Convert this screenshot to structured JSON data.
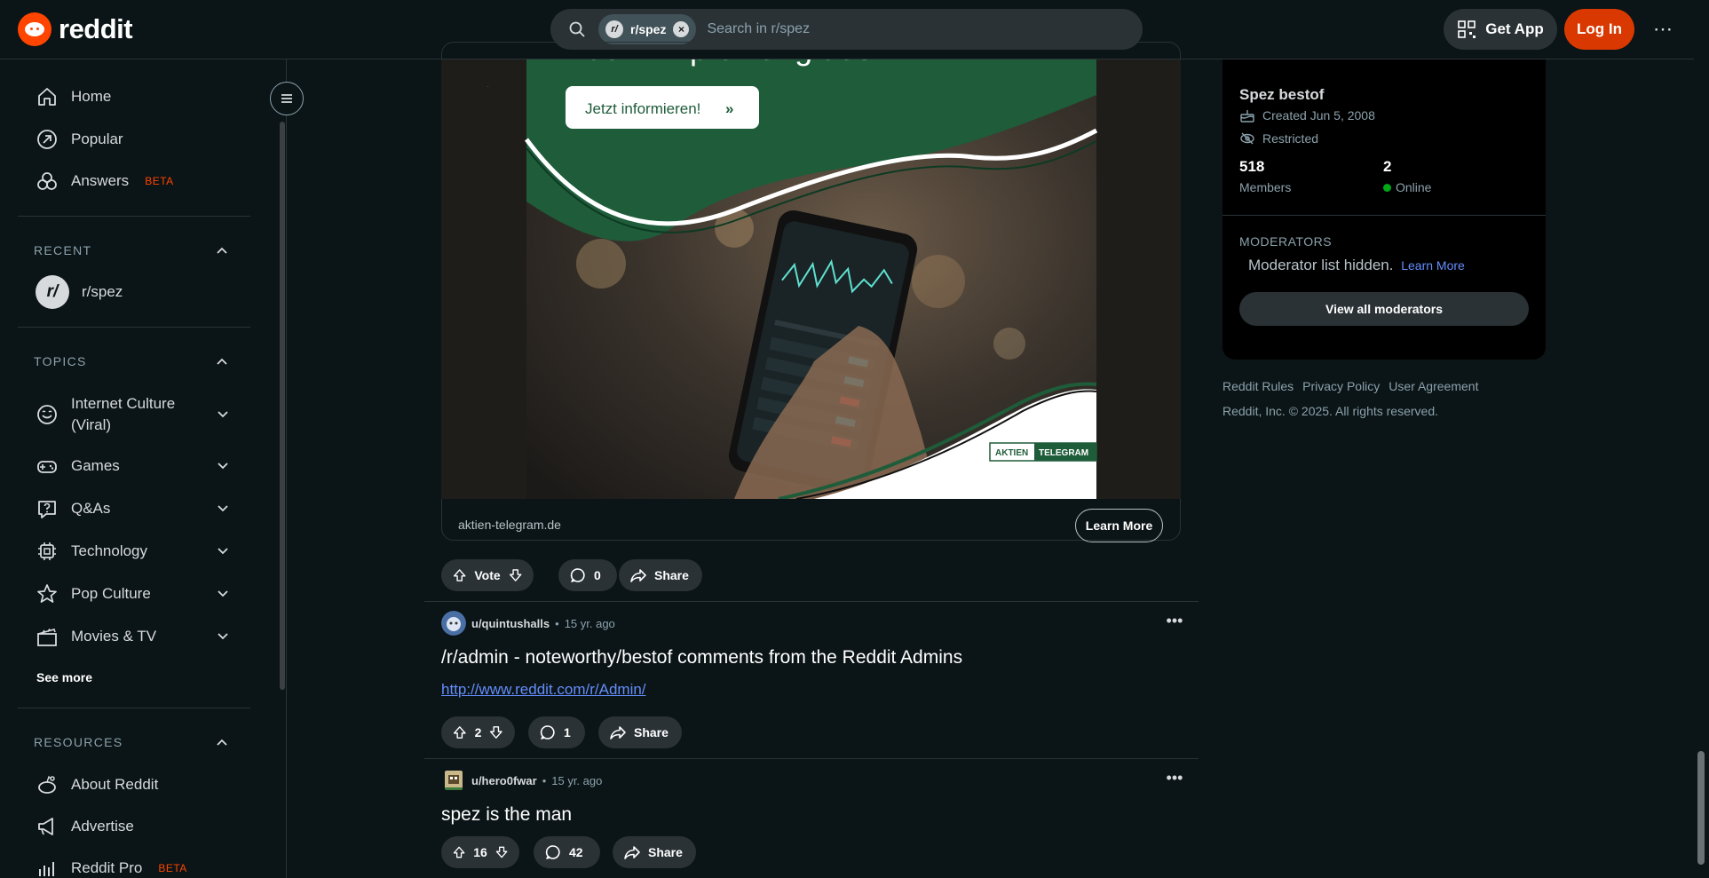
{
  "header": {
    "logo_text": "reddit",
    "search_chip": "r/spez",
    "search_chip_avatar": "r/",
    "search_placeholder": "Search in r/spez",
    "get_app": "Get App",
    "login": "Log In",
    "more": "⋯"
  },
  "sidebar": {
    "main_items": [
      {
        "label": "Home",
        "icon": "home-icon"
      },
      {
        "label": "Popular",
        "icon": "popular-icon"
      },
      {
        "label": "Answers",
        "icon": "answers-icon",
        "badge": "BETA"
      }
    ],
    "recent_title": "RECENT",
    "recent_items": [
      {
        "label": "r/spez",
        "avatar": "r/"
      }
    ],
    "topics_title": "TOPICS",
    "topics": [
      {
        "label": "Internet Culture (Viral)",
        "icon": "smile-icon"
      },
      {
        "label": "Games",
        "icon": "gamepad-icon"
      },
      {
        "label": "Q&As",
        "icon": "question-icon"
      },
      {
        "label": "Technology",
        "icon": "chip-icon"
      },
      {
        "label": "Pop Culture",
        "icon": "star-icon"
      },
      {
        "label": "Movies & TV",
        "icon": "clapper-icon"
      }
    ],
    "see_more": "See more",
    "resources_title": "RESOURCES",
    "resources": [
      {
        "label": "About Reddit",
        "icon": "about-icon"
      },
      {
        "label": "Advertise",
        "icon": "megaphone-icon"
      },
      {
        "label": "Reddit Pro",
        "icon": "chart-icon",
        "badge": "BETA"
      }
    ]
  },
  "ad": {
    "headline_fragment": "Kauf-Empfehlung aus",
    "cta_button": "Jetzt informieren!",
    "brand_left": "AKTIEN",
    "brand_right": "TELEGRAM",
    "domain": "aktien-telegram.de",
    "learn_more": "Learn More",
    "vote_label": "Vote",
    "comments": "0",
    "share": "Share"
  },
  "posts": [
    {
      "user": "u/quintushalls",
      "age": "15 yr. ago",
      "title": "/r/admin - noteworthy/bestof comments from the Reddit Admins",
      "link": "http://www.reddit.com/r/Admin/",
      "votes": "2",
      "comments": "1",
      "share": "Share"
    },
    {
      "user": "u/hero0fwar",
      "age": "15 yr. ago",
      "title": "spez is the man",
      "votes": "16",
      "comments": "42",
      "share": "Share"
    }
  ],
  "community": {
    "name": "Spez bestof",
    "created": "Created Jun 5, 2008",
    "status": "Restricted",
    "members_count": "518",
    "members_label": "Members",
    "online_count": "2",
    "online_label": "Online",
    "moderators_title": "MODERATORS",
    "moderators_hidden": "Moderator list hidden.",
    "moderators_learn": "Learn More",
    "view_all_mods": "View all moderators"
  },
  "footer": {
    "links": [
      "Reddit Rules",
      "Privacy Policy",
      "User Agreement"
    ],
    "copyright": "Reddit, Inc. © 2025. All rights reserved."
  },
  "colors": {
    "background": "#0b1416",
    "accent": "#ff4500",
    "login": "#d93900",
    "link": "#648efc",
    "online": "#01a816"
  }
}
